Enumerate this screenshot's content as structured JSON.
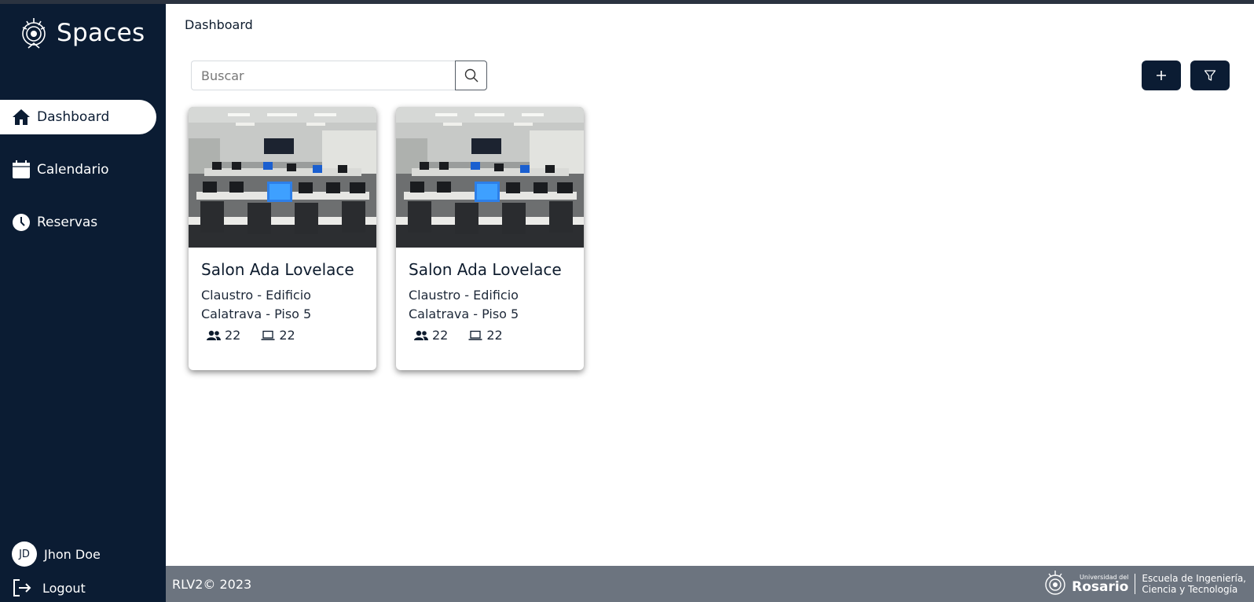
{
  "app": {
    "name": "Spaces"
  },
  "sidebar": {
    "items": [
      {
        "label": "Dashboard",
        "icon": "home-icon",
        "active": true
      },
      {
        "label": "Calendario",
        "icon": "calendar-icon",
        "active": false
      },
      {
        "label": "Reservas",
        "icon": "clock-icon",
        "active": false
      }
    ],
    "user": {
      "initials": "JD",
      "name": "Jhon Doe"
    },
    "logout_label": "Logout"
  },
  "header": {
    "breadcrumb": "Dashboard"
  },
  "search": {
    "placeholder": "Buscar",
    "value": ""
  },
  "toolbar": {
    "add_icon": "plus-icon",
    "filter_icon": "filter-icon"
  },
  "cards": [
    {
      "title": "Salon Ada Lovelace",
      "location": "Claustro - Edificio Calatrava - Piso 5",
      "capacity": "22",
      "computers": "22"
    },
    {
      "title": "Salon Ada Lovelace",
      "location": "Claustro - Edificio Calatrava - Piso 5",
      "capacity": "22",
      "computers": "22"
    }
  ],
  "footer": {
    "copyright": "RLV2© 2023",
    "university_small": "Universidad del",
    "university_big": "Rosario",
    "school_line1": "Escuela de Ingeniería,",
    "school_line2": "Ciencia y Tecnología"
  },
  "colors": {
    "sidebar": "#0b1c33",
    "footer": "#6c747f",
    "accent": "#0b1c33"
  }
}
